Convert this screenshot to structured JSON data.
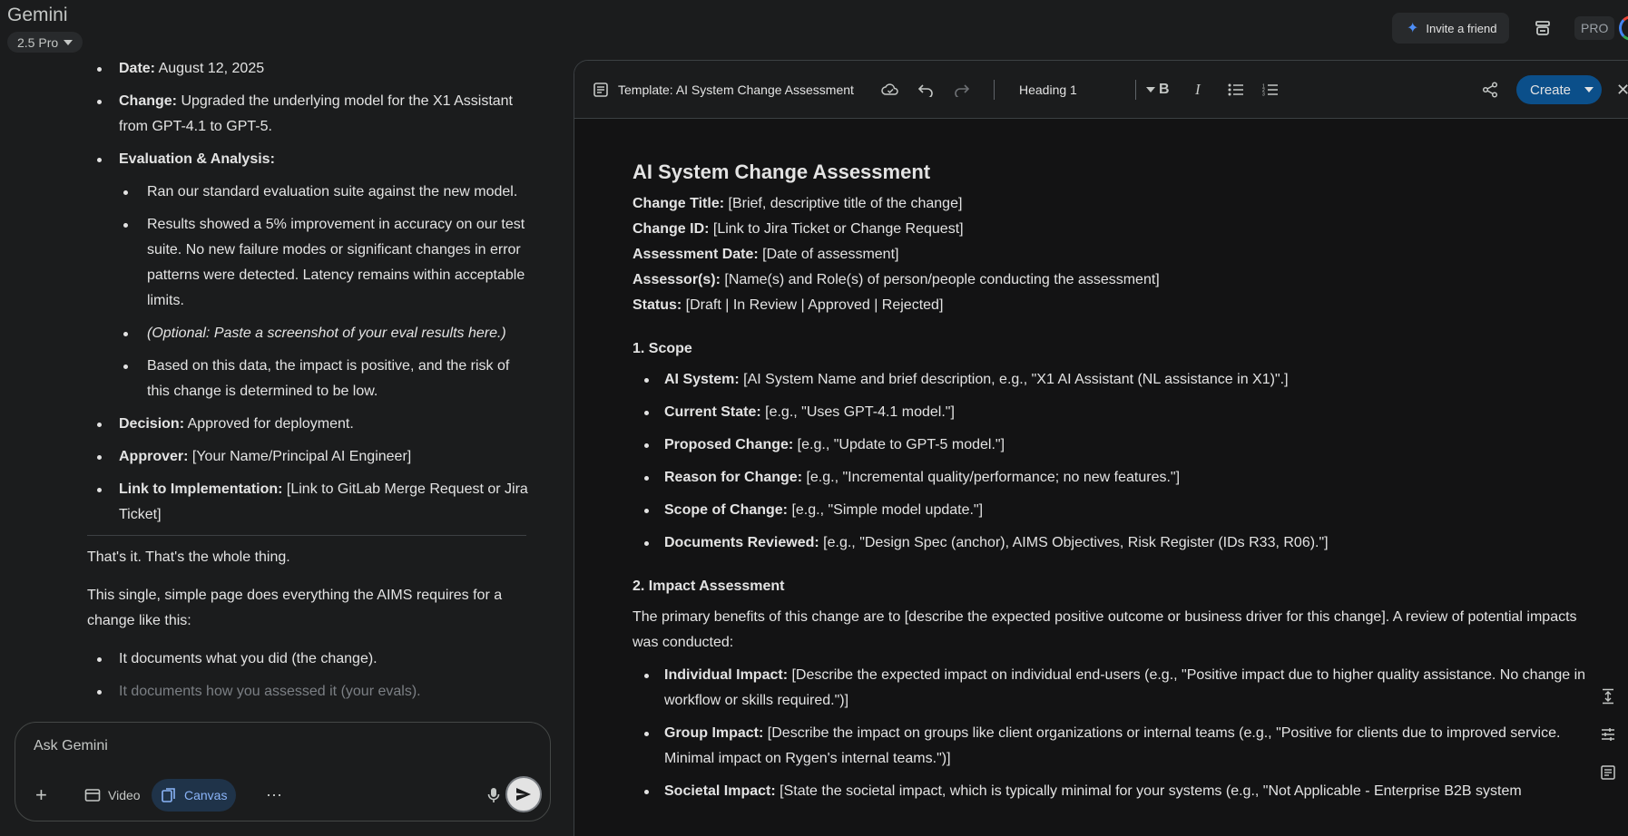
{
  "header": {
    "brand": "Gemini",
    "model": "2.5 Pro",
    "invite": "Invite a friend",
    "pro": "PRO"
  },
  "chat": {
    "items": [
      {
        "label": "Date:",
        "text": " August 12, 2025"
      },
      {
        "label": "Change:",
        "text": " Upgraded the underlying model for the X1 Assistant from GPT-4.1 to GPT-5."
      },
      {
        "label": "Evaluation & Analysis:",
        "text": ""
      }
    ],
    "subitems": [
      "Ran our standard evaluation suite against the new model.",
      "Results showed a 5% improvement in accuracy on our test suite. No new failure modes or significant changes in error patterns were detected. Latency remains within acceptable limits.",
      "(Optional: Paste a screenshot of your eval results here.)",
      "Based on this data, the impact is positive, and the risk of this change is determined to be low."
    ],
    "items2": [
      {
        "label": "Decision:",
        "text": " Approved for deployment."
      },
      {
        "label": "Approver:",
        "text": " [Your Name/Principal AI Engineer]"
      },
      {
        "label": "Link to Implementation:",
        "text": " [Link to GitLab Merge Request or Jira Ticket]"
      }
    ],
    "para1": "That's it. That's the whole thing.",
    "para2": "This single, simple page does everything the AIMS requires for a change like this:",
    "bullets": [
      "It documents what you did (the change).",
      "It documents how you assessed it (your evals)."
    ]
  },
  "input": {
    "placeholder": "Ask Gemini",
    "video": "Video",
    "canvas": "Canvas"
  },
  "toolbar": {
    "title": "Template: AI System Change Assessment",
    "style": "Heading 1",
    "create": "Create"
  },
  "doc": {
    "title": "AI System Change Assessment",
    "meta": [
      {
        "label": "Change Title:",
        "text": " [Brief, descriptive title of the change]"
      },
      {
        "label": "Change ID:",
        "text": " [Link to Jira Ticket or Change Request]"
      },
      {
        "label": "Assessment Date:",
        "text": " [Date of assessment]"
      },
      {
        "label": "Assessor(s):",
        "text": " [Name(s) and Role(s) of person/people conducting the assessment]"
      },
      {
        "label": "Status:",
        "text": " [Draft | In Review | Approved | Rejected]"
      }
    ],
    "section1": "1. Scope",
    "scope": [
      {
        "label": "AI System:",
        "text": " [AI System Name and brief description, e.g., \"X1 AI Assistant (NL assistance in X1)\".]"
      },
      {
        "label": "Current State:",
        "text": " [e.g., \"Uses GPT-4.1 model.\"]"
      },
      {
        "label": "Proposed Change:",
        "text": " [e.g., \"Update to GPT-5 model.\"]"
      },
      {
        "label": "Reason for Change:",
        "text": " [e.g., \"Incremental quality/performance; no new features.\"]"
      },
      {
        "label": "Scope of Change:",
        "text": " [e.g., \"Simple model update.\"]"
      },
      {
        "label": "Documents Reviewed:",
        "text": " [e.g., \"Design Spec (anchor), AIMS Objectives, Risk Register (IDs R33, R06).\"]"
      }
    ],
    "section2": "2. Impact Assessment",
    "impact_intro": "The primary benefits of this change are to [describe the expected positive outcome or business driver for this change]. A review of potential impacts was conducted:",
    "impacts": [
      {
        "label": "Individual Impact:",
        "text": " [Describe the expected impact on individual end-users (e.g., \"Positive impact due to higher quality assistance. No change in workflow or skills required.\")]"
      },
      {
        "label": "Group Impact:",
        "text": " [Describe the impact on groups like client organizations or internal teams (e.g., \"Positive for clients due to improved service. Minimal impact on Rygen's internal teams.\")]"
      },
      {
        "label": "Societal Impact:",
        "text": " [State the societal impact, which is typically minimal for your systems (e.g., \"Not Applicable - Enterprise B2B system"
      }
    ]
  }
}
